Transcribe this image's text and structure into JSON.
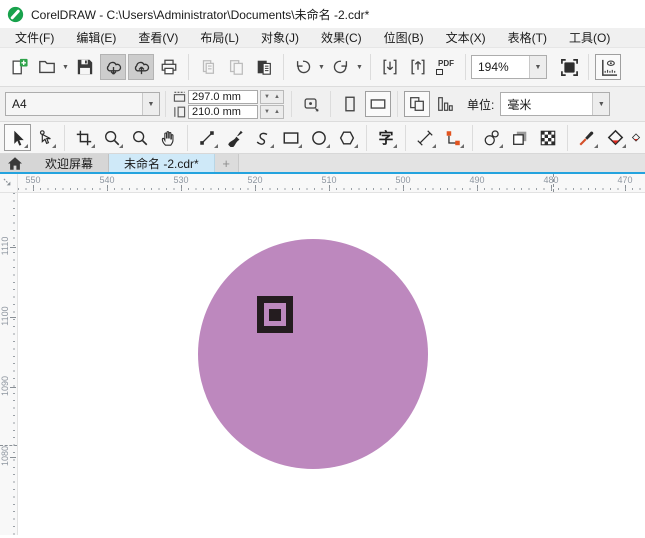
{
  "window": {
    "title": "CorelDRAW - C:\\Users\\Administrator\\Documents\\未命名 -2.cdr*"
  },
  "menu": {
    "items": [
      "文件(F)",
      "编辑(E)",
      "查看(V)",
      "布局(L)",
      "对象(J)",
      "效果(C)",
      "位图(B)",
      "文本(X)",
      "表格(T)",
      "工具(O)"
    ]
  },
  "toolbar": {
    "zoom_level": "194%",
    "pdf_label": "PDF"
  },
  "property_bar": {
    "page_size": "A4",
    "page_width": "297.0 mm",
    "page_height": "210.0 mm",
    "units_label": "单位:",
    "units_value": "毫米"
  },
  "tabs": {
    "welcome": "欢迎屏幕",
    "document": "未命名 -2.cdr*",
    "new_tab": "+"
  },
  "rulers": {
    "horizontal": [
      "550",
      "540",
      "530",
      "520",
      "510",
      "500",
      "490",
      "480",
      "470"
    ],
    "vertical": [
      "1110",
      "1100",
      "1090",
      "1080"
    ]
  },
  "tools": {
    "text_tool_glyph": "字"
  },
  "canvas": {
    "shapes": [
      {
        "type": "circle",
        "fill": "#bd88be"
      },
      {
        "type": "framed-square-symbol",
        "color": "#241c1f",
        "position": "upper-left-inside-circle"
      }
    ]
  },
  "colors": {
    "accent_blue": "#24a3de",
    "active_tab": "#cfe9f8",
    "circle_fill": "#bd88be",
    "app_green": "#18a24c"
  }
}
